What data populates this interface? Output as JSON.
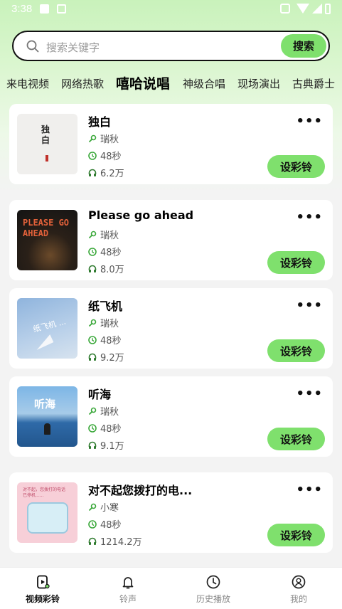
{
  "status_bar": {
    "time": "3:38"
  },
  "search": {
    "placeholder": "搜索关键字",
    "button_label": "搜索"
  },
  "tabs": [
    {
      "label": "来电视频"
    },
    {
      "label": "网络热歌"
    },
    {
      "label": "嘻哈说唱",
      "active": true
    },
    {
      "label": "神级合唱"
    },
    {
      "label": "现场演出"
    },
    {
      "label": "古典爵士"
    }
  ],
  "songs": [
    {
      "title": "独白",
      "artist": "瑞秋",
      "duration": "48秒",
      "plays": "6.2万",
      "thumb_text": "独\n白",
      "button_label": "设彩铃"
    },
    {
      "title": "Please go ahead",
      "artist": "瑞秋",
      "duration": "48秒",
      "plays": "8.0万",
      "thumb_text": "PLEASE GO\nAHEAD",
      "button_label": "设彩铃"
    },
    {
      "title": "纸飞机",
      "artist": "瑞秋",
      "duration": "48秒",
      "plays": "9.2万",
      "thumb_text": "纸飞机 ...",
      "button_label": "设彩铃"
    },
    {
      "title": "听海",
      "artist": "瑞秋",
      "duration": "48秒",
      "plays": "9.1万",
      "thumb_text": "听海",
      "button_label": "设彩铃"
    },
    {
      "title": "对不起您拨打的电...",
      "artist": "小寒",
      "duration": "48秒",
      "plays": "1214.2万",
      "thumb_text": "对不起，您拨打的电话\n已停机......",
      "button_label": "设彩铃"
    }
  ],
  "more_label": "•••",
  "bottom_nav": [
    {
      "label": "视频彩铃",
      "icon": "video-ringtone-icon",
      "active": true
    },
    {
      "label": "铃声",
      "icon": "bell-icon"
    },
    {
      "label": "历史播放",
      "icon": "clock-icon"
    },
    {
      "label": "我的",
      "icon": "profile-icon"
    }
  ],
  "colors": {
    "accent": "#7fe06d",
    "header_gradient_top": "#c9f2bb",
    "background": "#f3f3f3"
  }
}
